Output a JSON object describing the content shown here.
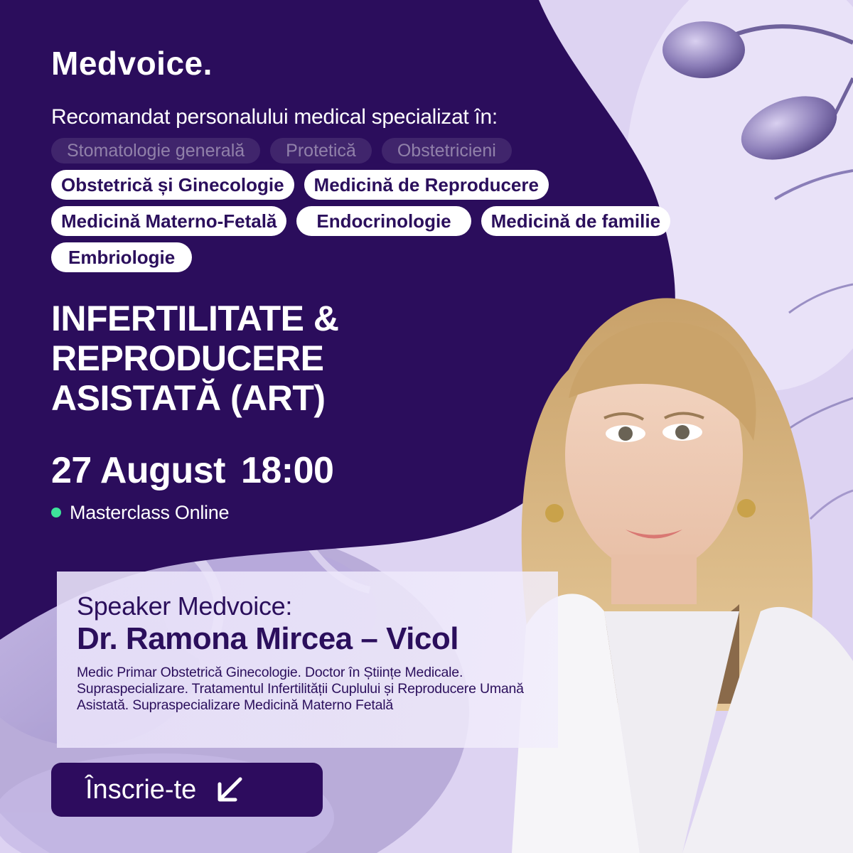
{
  "brand": {
    "logo_text": "Medvoice."
  },
  "recommendation": {
    "intro": "Recomandat personalului medical specializat în:",
    "muted_tags": [
      "Stomatologie generală",
      "Protetică",
      "Obstetricieni"
    ],
    "tags": [
      "Obstetrică și Ginecologie",
      "Medicină de Reproducere",
      "Medicină Materno-Fetală",
      "Endocrinologie",
      "Medicină de familie",
      "Embriologie"
    ]
  },
  "event": {
    "title_lines": [
      "INFERTILITATE &",
      "REPRODUCERE",
      "ASISTATĂ (ART)"
    ],
    "date": "27 August",
    "time": "18:00",
    "format": "Masterclass Online"
  },
  "speaker": {
    "label": "Speaker Medvoice:",
    "name": "Dr. Ramona Mircea – Vicol",
    "description": "Medic Primar Obstetrică Ginecologie. Doctor în Științe Medicale. Supraspecializare. Tratamentul Infertilității Cuplului și Reproducere Umană Asistată. Supraspecializare Medicină Materno Fetală"
  },
  "cta": {
    "register_label": "Înscrie-te",
    "icon": "arrow-down-left-icon"
  },
  "colors": {
    "panel": "#2b0d5c",
    "lavender": "#ddd3f2",
    "text_dark": "#2b0f5c",
    "online_dot": "#3ee39a"
  }
}
